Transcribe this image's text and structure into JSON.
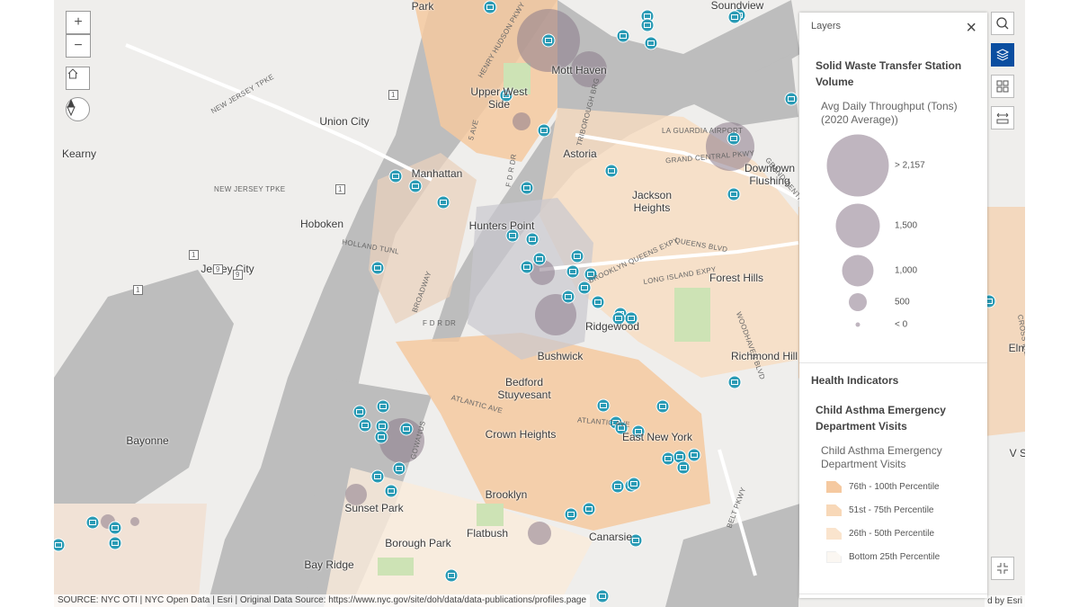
{
  "map": {
    "labels": [
      "Park",
      "Soundview",
      "Mott Haven",
      "Upper West Side",
      "Union City",
      "Kearny",
      "Manhattan",
      "Astoria",
      "Downtown Flushing",
      "Jackson Heights",
      "Hoboken",
      "Hunters Point",
      "Jersey City",
      "Forest Hills",
      "Ridgewood",
      "Bushwick",
      "Richmond Hill",
      "Bedford Stuyvesant",
      "Bayonne",
      "Crown Heights",
      "East New York",
      "Brooklyn",
      "Sunset Park",
      "Flatbush",
      "Canarsie",
      "Borough Park",
      "Bay Ridge",
      "Elm",
      "V St"
    ],
    "roads": [
      "HENRY HUDSON PKWY",
      "NEW JERSEY TPKE",
      "NEW JERSEY TPKE",
      "5 AVE",
      "F D R DR",
      "TRIBOROUGH BRG",
      "LA GUARDIA AIRPORT",
      "GRAND CENTRAL PKWY",
      "GRAND CENTRAL PKWY",
      "HOLLAND TUNL",
      "BROADWAY",
      "BROOKLYN QUEENS EXPY",
      "QUEENS BLVD",
      "LONG ISLAND EXPY",
      "F D R DR",
      "ATLANTIC AVE",
      "ATLANTIC AVE",
      "GOWANUS",
      "BELT PKWY",
      "WOODHAVEN BLVD",
      "CROSS ISLAND PKWY",
      "1",
      "1",
      "1",
      "9",
      "9",
      "1"
    ],
    "attribution": "SOURCE: NYC OTI | NYC Open Data | Esri | Original Data Source: https://www.nyc.gov/site/doh/data/data-publications/profiles.page",
    "attribution_right": "d by Esri",
    "colors": {
      "water": "#bdbdbd",
      "land": "#efeeec",
      "park": "#cde3b5",
      "station": "#2a9bb5",
      "volume": "#8a7a8a",
      "asthma_high": "#f5c9a0",
      "asthma_mid": "#f8dcc0",
      "asthma_low": "#faebdb"
    }
  },
  "controls": {
    "zoom_in": "+",
    "zoom_out": "−",
    "home_icon": "home-icon",
    "compass_icon": "compass-icon"
  },
  "toolbar": {
    "search": "search-icon",
    "layers": "layers-icon",
    "legend": "legend-icon",
    "measure": "measure-icon",
    "collapse": "collapse-icon",
    "active_color": "#0a4ea0"
  },
  "panel": {
    "title": "Layers",
    "close": "×",
    "layer1": {
      "title": "Solid Waste Transfer Station Volume",
      "field": "Avg Daily Throughput (Tons) (2020 Average))",
      "classes": [
        {
          "label": "> 2,157"
        },
        {
          "label": "1,500"
        },
        {
          "label": "1,000"
        },
        {
          "label": "500"
        },
        {
          "label": "< 0"
        }
      ]
    },
    "group2": "Health Indicators",
    "layer2": {
      "title": "Child Asthma Emergency Department Visits",
      "field": "Child Asthma Emergency Department Visits",
      "classes": [
        {
          "label": "76th - 100th Percentile",
          "color": "#f5c9a0"
        },
        {
          "label": "51st - 75th Percentile",
          "color": "#f8d8b8"
        },
        {
          "label": "26th - 50th Percentile",
          "color": "#fae4cd"
        },
        {
          "label": "Bottom 25th Percentile",
          "color": "#fbf7f2"
        }
      ]
    }
  }
}
